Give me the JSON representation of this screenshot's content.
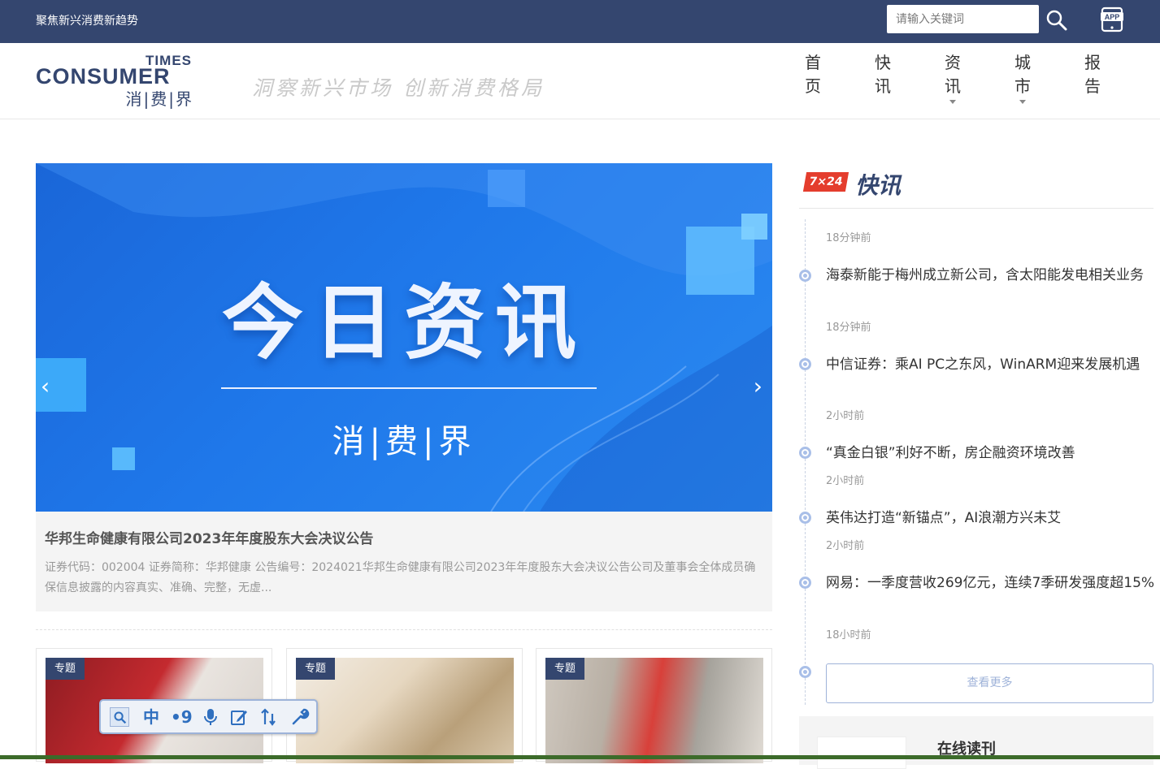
{
  "topbar": {
    "slogan": "聚焦新兴消费新趋势",
    "search_placeholder": "请输入关键词",
    "app_label": "APP"
  },
  "header": {
    "logo_times": "TIMES",
    "logo_consumer": "CONSUMER",
    "logo_cn": "消|费|界",
    "tagline": "洞察新兴市场 创新消费格局",
    "nav": [
      {
        "label": "首页",
        "has_dropdown": false
      },
      {
        "label": "快讯",
        "has_dropdown": false
      },
      {
        "label": "资讯",
        "has_dropdown": true
      },
      {
        "label": "城市",
        "has_dropdown": true
      },
      {
        "label": "报告",
        "has_dropdown": false
      }
    ]
  },
  "banner": {
    "headline": "今日资讯",
    "sub": "消|费|界",
    "prev": "‹",
    "next": "›",
    "caption_title": "华邦生命健康有限公司2023年年度股东大会决议公告",
    "caption_desc": "证券代码：002004 证券简称：华邦健康 公告编号：2024021华邦生命健康有限公司2023年年度股东大会决议公告公司及董事会全体成员确保信息披露的内容真实、准确、完整，无虚..."
  },
  "cards": [
    {
      "tag": "专题"
    },
    {
      "tag": "专题"
    },
    {
      "tag": "专题"
    }
  ],
  "sidebar": {
    "badge": "7×24",
    "title": "快讯",
    "first_time": "18分钟前",
    "news": [
      {
        "title": "海泰新能于梅州成立新公司，含太阳能发电相关业务",
        "time": "18分钟前"
      },
      {
        "title": "中信证券：乘AI PC之东风，WinARM迎来发展机遇",
        "time": "2小时前"
      },
      {
        "title": "“真金白银”利好不断，房企融资环境改善",
        "time": "2小时前"
      },
      {
        "title": "英伟达打造“新锚点”，AI浪潮方兴未艾",
        "time": "2小时前"
      },
      {
        "title": "网易：一季度营收269亿元，连续7季研发强度超15%",
        "time": "18小时前"
      }
    ],
    "more_label": "查看更多",
    "magazine_label": "在线读刊"
  },
  "toolbar": {
    "tools": [
      "screen-read",
      "中",
      "•9",
      "mic",
      "edit",
      "text-size",
      "settings"
    ]
  },
  "colors": {
    "navy": "#34466f",
    "accent_red": "#e43d2d",
    "banner_blue": "#1f78ea"
  }
}
